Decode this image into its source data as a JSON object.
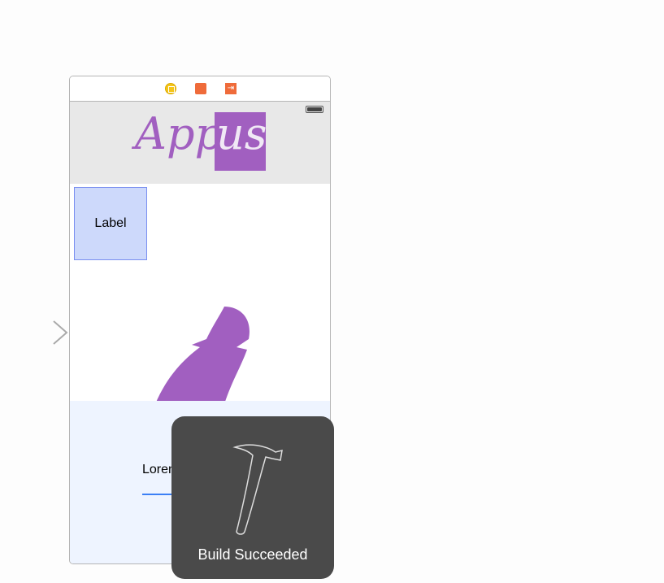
{
  "scene": {
    "dock_icons": [
      "view-controller-icon",
      "first-responder-icon",
      "exit-icon"
    ],
    "logo_text": {
      "part1": "App",
      "part2": "us"
    },
    "label_text": "Label",
    "text_field_value": "Lorem"
  },
  "hud": {
    "icon": "hammer-icon",
    "message": "Build Succeeded"
  },
  "colors": {
    "brand_purple": "#a15fc0",
    "accent_blue": "#3b7ff5",
    "hud_bg": "#4a4a4a"
  }
}
